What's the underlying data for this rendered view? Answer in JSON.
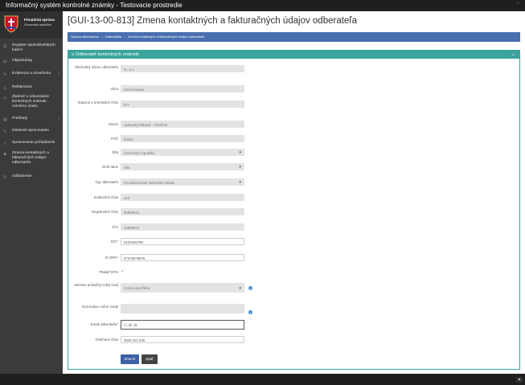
{
  "app": {
    "title": "Informačný systém kontrolné známky - Testovacie prostredie",
    "menu_icon": "chevron-up-icon"
  },
  "brand": {
    "name": "Finančná správa",
    "sub": "Slovenská republika"
  },
  "sidebar": {
    "items": [
      {
        "label": "Register spotrebiteľských balení",
        "icon": "list-icon"
      },
      {
        "label": "Objednávky",
        "icon": "cart-icon"
      },
      {
        "label": "Evidencia a označenia",
        "icon": "edit-icon",
        "arrow": "›"
      },
      {
        "label": "Reklamácie",
        "icon": "warning-icon"
      },
      {
        "label": "Žiadosť o odovzdanie kontrolných známok colnému úradu",
        "icon": "handover-icon"
      },
      {
        "label": "Prehľady",
        "icon": "chart-icon",
        "arrow": "›"
      },
      {
        "label": "Dávkové spracovanie",
        "icon": "upload-icon"
      },
      {
        "label": "Spracovanie požiadaviek",
        "icon": "inbox-icon"
      },
      {
        "label": "Zmena kontaktných a fakturačných údajov odberateľa",
        "icon": "user-icon"
      },
      {
        "label": "Odhlásenie",
        "icon": "logout-icon"
      }
    ]
  },
  "page": {
    "title": "[GUI-13-00-813] Zmena kontaktných a fakturačných údajov odberateľa",
    "breadcrumb": [
      "Správa odberateľov",
      "Odberatelia",
      "Zmena kontaktných a fakturačných údajov odberateľa"
    ],
    "breadcrumb_sep": "›"
  },
  "panel": {
    "title": "Odberateľ kontrolných známok",
    "title_icon": "≡",
    "toggle": "⌄"
  },
  "form": {
    "obchodny_nazov": {
      "label": "Obchodný názov odberateľa",
      "value": "N      , a.s."
    },
    "ulica": {
      "label": "Ulica",
      "value": "Smrečianska"
    },
    "supisne": {
      "label": "Súpisné a orientačné číslo",
      "value": "677"
    },
    "mesto": {
      "label": "Mesto",
      "value": "Liptovský Mikuláš - Okoličné"
    },
    "psc": {
      "label": "PSČ",
      "value": "03104"
    },
    "stat": {
      "label": "Štát",
      "value": "Slovenská republika"
    },
    "druh_dane": {
      "label": "Druh dane",
      "value": "SBL"
    },
    "typ_odberatela": {
      "label": "Typ odberateľa",
      "value": "Prevádzkovateľ daňového skladu"
    },
    "evidencne_cislo": {
      "label": "Evidenčné číslo",
      "value": "123"
    },
    "registracne_cislo": {
      "label": "Registračné číslo",
      "value": "66899513"
    },
    "ico": {
      "label": "IČO",
      "value": "14568874"
    },
    "dic": {
      "label": "DIČ",
      "required": "*",
      "value": "0123456789"
    },
    "ic_dph": {
      "label": "IČ DPH",
      "required": "*",
      "value": "57378678876"
    },
    "platitel_dph": {
      "label": "Platiteľ DPH",
      "checkmark": "✓"
    },
    "miestne_prislusny": {
      "label": "Miestne príslušný colný úrad",
      "value": "Colný úrad Žilina",
      "info": "i"
    },
    "dozorujuce": {
      "label": "Dozorujúce colné úrady",
      "value": "",
      "info": "i"
    },
    "email": {
      "label": "Email odberateľa",
      "required": "*",
      "value": "z  |   @    .sk"
    },
    "telefon": {
      "label": "Telefónne číslo",
      "value": "0949 222 645"
    }
  },
  "buttons": {
    "submit": "Zmeniť",
    "back": "Späť"
  },
  "footer": {
    "scroll_top": "▲"
  }
}
